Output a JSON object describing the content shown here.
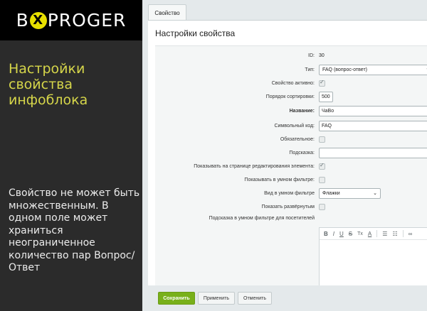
{
  "brand": {
    "logo_left": "B",
    "logo_x": "X",
    "logo_right": "PROGER"
  },
  "left": {
    "title": "Настройки свойства инфоблока",
    "description": "Свойство не может быть множественным. В одном поле может храниться неограниченное количество пар Вопрос/Ответ"
  },
  "tab": {
    "label": "Свойство"
  },
  "panel": {
    "title": "Настройки свойства"
  },
  "form": {
    "id_label": "ID:",
    "id_value": "30",
    "type_label": "Тип:",
    "type_value": "FAQ (вопрос-ответ)",
    "active_label": "Свойство активно:",
    "active_checked": true,
    "sort_label": "Порядок сортировки:",
    "sort_value": "500",
    "name_label": "Название:",
    "name_value": "ЧаВо",
    "code_label": "Символьный код:",
    "code_value": "FAQ",
    "required_label": "Обязательное:",
    "required_checked": false,
    "hint_label": "Подсказка:",
    "hint_value": "",
    "show_edit_label": "Показывать на странице редактирования элемента:",
    "show_edit_checked": true,
    "smart_filter_label": "Показывать в умном фильтре:",
    "smart_filter_checked": false,
    "smart_view_label": "Вид в умном фильтре",
    "smart_view_value": "Флажки",
    "expanded_label": "Показать развёрнутым",
    "expanded_checked": false,
    "visitor_hint_label": "Подсказка в умном фильтре для посетителей"
  },
  "editor_toolbar": [
    "B",
    "I",
    "U",
    "S",
    "Tx",
    "A",
    "ol-icon",
    "ul-icon",
    "link-icon"
  ],
  "buttons": {
    "save": "Сохранить",
    "apply": "Применить",
    "cancel": "Отменить"
  },
  "colors": {
    "accent": "#e8e000",
    "left_title": "#d6d64a",
    "save_button": "#78b01a"
  }
}
